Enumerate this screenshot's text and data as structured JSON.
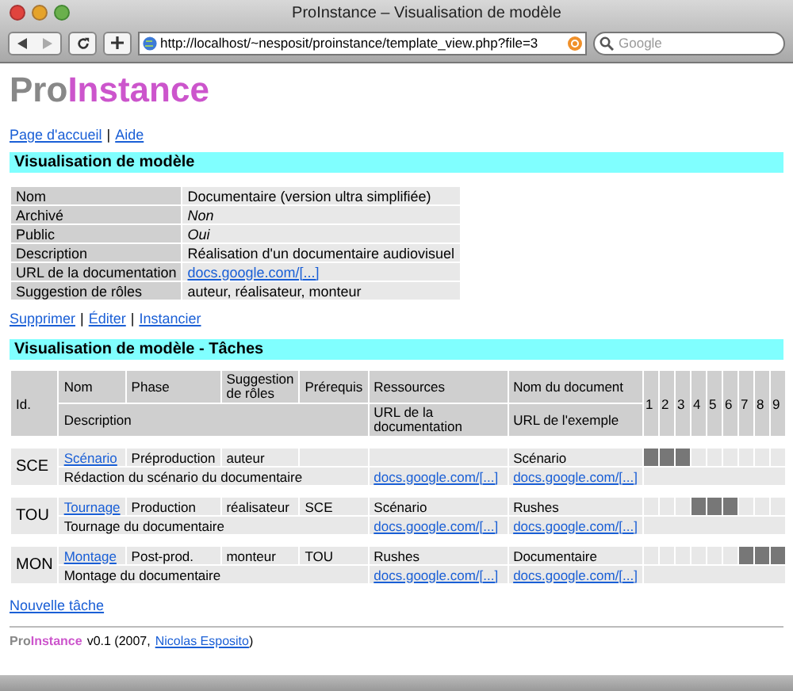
{
  "window": {
    "title": "ProInstance – Visualisation de modèle"
  },
  "toolbar": {
    "url": "http://localhost/~nesposit/proinstance/template_view.php?file=3",
    "search": {
      "placeholder": "Google"
    }
  },
  "logo": {
    "part_1": "Pro",
    "part_2": "Instance"
  },
  "separator": "|",
  "nav": [
    "Page d'accueil",
    "Aide"
  ],
  "section_1": {
    "title": "Visualisation de modèle"
  },
  "details": [
    {
      "label": "Nom",
      "value": "Documentaire (version ultra simplifiée)",
      "kind": "text"
    },
    {
      "label": "Archivé",
      "value": "Non",
      "kind": "italic"
    },
    {
      "label": "Public",
      "value": "Oui",
      "kind": "italic"
    },
    {
      "label": "Description",
      "value": "Réalisation d'un documentaire audiovisuel",
      "kind": "text"
    },
    {
      "label": "URL de la documentation",
      "value": "docs.google.com/[...]",
      "kind": "link"
    },
    {
      "label": "Suggestion de rôles",
      "value": "auteur, réalisateur, monteur",
      "kind": "text"
    }
  ],
  "actions": [
    "Supprimer",
    "Éditer",
    "Instancier"
  ],
  "section_2": {
    "title": "Visualisation de modèle - Tâches"
  },
  "task_table": {
    "headers": {
      "id": "Id.",
      "name": "Nom",
      "phase": "Phase",
      "roles": "Suggestion de rôles",
      "prereq": "Prérequis",
      "resources": "Ressources",
      "doc_name": "Nom du document",
      "description": "Description",
      "doc_url": "URL de la documentation",
      "example_url": "URL de l'exemple",
      "slots": [
        "1",
        "2",
        "3",
        "4",
        "5",
        "6",
        "7",
        "8",
        "9"
      ]
    },
    "tasks": [
      {
        "id": "SCE",
        "name": "Scénario",
        "phase": "Préproduction",
        "roles": "auteur",
        "doc_name": "Scénario",
        "description": "Rédaction du scénario du documentaire",
        "doc_url": "docs.google.com/[...]",
        "example_url": "docs.google.com/[...]",
        "schedule": [
          true,
          true,
          true,
          false,
          false,
          false,
          false,
          false,
          false
        ]
      },
      {
        "id": "TOU",
        "name": "Tournage",
        "phase": "Production",
        "roles": "réalisateur",
        "prereq": "SCE",
        "resources": "Scénario",
        "doc_name": "Rushes",
        "description": "Tournage du documentaire",
        "doc_url": "docs.google.com/[...]",
        "example_url": "docs.google.com/[...]",
        "schedule": [
          false,
          false,
          false,
          true,
          true,
          true,
          false,
          false,
          false
        ]
      },
      {
        "id": "MON",
        "name": "Montage",
        "phase": "Post-prod.",
        "roles": "monteur",
        "prereq": "TOU",
        "resources": "Rushes",
        "doc_name": "Documentaire",
        "description": "Montage du documentaire",
        "doc_url": "docs.google.com/[...]",
        "example_url": "docs.google.com/[...]",
        "schedule": [
          false,
          false,
          false,
          false,
          false,
          false,
          true,
          true,
          true
        ]
      }
    ]
  },
  "new_task": "Nouvelle tâche",
  "footer": {
    "logo_part_1": "Pro",
    "logo_part_2": "Instance",
    "text": "v0.1 (2007,",
    "author": "Nicolas Esposito",
    "closing": ")"
  }
}
